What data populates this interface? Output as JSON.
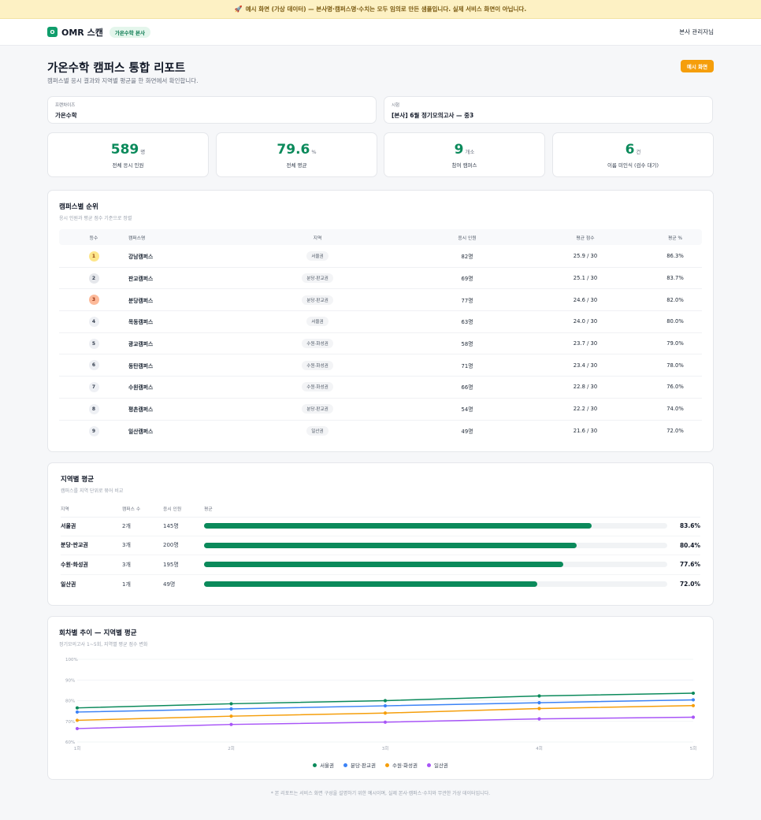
{
  "banner": {
    "icon": "🚀",
    "text": "예시 화면 (가상 데이터) — 본사명·캠퍼스명·수치는 모두 임의로 만든 샘플입니다. 실제 서비스 화면이 아닙니다."
  },
  "header": {
    "logo_mark": "O",
    "app_name": "OMR 스캔",
    "brand_badge": "가온수학 본사",
    "user": "본사 관리자님"
  },
  "page": {
    "title": "가온수학 캠퍼스 통합 리포트",
    "subtitle": "캠퍼스별 응시 결과와 지역별 평균을 한 화면에서 확인합니다.",
    "example_button": "예시 화면"
  },
  "filters": {
    "franchise": {
      "label": "프랜차이즈",
      "value": "가온수학"
    },
    "exam": {
      "label": "시험",
      "value": "[본사] 6월 정기모의고사 — 중3"
    }
  },
  "stats": [
    {
      "value": "589",
      "unit": "명",
      "caption": "전체 응시 인원"
    },
    {
      "value": "79.6",
      "unit": "%",
      "caption": "전체 평균"
    },
    {
      "value": "9",
      "unit": "개소",
      "caption": "참여 캠퍼스"
    },
    {
      "value": "6",
      "unit": "건",
      "caption": "이름 미인식 (검수 대기)"
    }
  ],
  "ranking": {
    "title": "캠퍼스별 순위",
    "subtitle": "응시 인원과 평균 점수 기준으로 정렬",
    "columns": [
      "등수",
      "캠퍼스명",
      "지역",
      "응시 인원",
      "평균 점수",
      "평균 %"
    ],
    "rows": [
      {
        "rank": "1",
        "name": "강남캠퍼스",
        "region": "서울권",
        "count": "82명",
        "avg": "25.9 / 30",
        "pct": "86.3%"
      },
      {
        "rank": "2",
        "name": "판교캠퍼스",
        "region": "분당·판교권",
        "count": "69명",
        "avg": "25.1 / 30",
        "pct": "83.7%"
      },
      {
        "rank": "3",
        "name": "분당캠퍼스",
        "region": "분당·판교권",
        "count": "77명",
        "avg": "24.6 / 30",
        "pct": "82.0%"
      },
      {
        "rank": "4",
        "name": "목동캠퍼스",
        "region": "서울권",
        "count": "63명",
        "avg": "24.0 / 30",
        "pct": "80.0%"
      },
      {
        "rank": "5",
        "name": "광교캠퍼스",
        "region": "수원·화성권",
        "count": "58명",
        "avg": "23.7 / 30",
        "pct": "79.0%"
      },
      {
        "rank": "6",
        "name": "동탄캠퍼스",
        "region": "수원·화성권",
        "count": "71명",
        "avg": "23.4 / 30",
        "pct": "78.0%"
      },
      {
        "rank": "7",
        "name": "수원캠퍼스",
        "region": "수원·화성권",
        "count": "66명",
        "avg": "22.8 / 30",
        "pct": "76.0%"
      },
      {
        "rank": "8",
        "name": "평촌캠퍼스",
        "region": "분당·판교권",
        "count": "54명",
        "avg": "22.2 / 30",
        "pct": "74.0%"
      },
      {
        "rank": "9",
        "name": "일산캠퍼스",
        "region": "일산권",
        "count": "49명",
        "avg": "21.6 / 30",
        "pct": "72.0%"
      }
    ]
  },
  "regions": {
    "title": "지역별 평균",
    "subtitle": "캠퍼스를 지역 단위로 묶어 비교",
    "columns": [
      "지역",
      "캠퍼스 수",
      "응시 인원",
      "평균"
    ],
    "rows": [
      {
        "name": "서울권",
        "campuses": "2개",
        "count": "145명",
        "pct_label": "83.6%",
        "pct": 83.6
      },
      {
        "name": "분당·판교권",
        "campuses": "3개",
        "count": "200명",
        "pct_label": "80.4%",
        "pct": 80.4
      },
      {
        "name": "수원·화성권",
        "campuses": "3개",
        "count": "195명",
        "pct_label": "77.6%",
        "pct": 77.6
      },
      {
        "name": "일산권",
        "campuses": "1개",
        "count": "49명",
        "pct_label": "72.0%",
        "pct": 72.0
      }
    ]
  },
  "trend": {
    "title": "회차별 추이 — 지역별 평균",
    "subtitle": "정기모의고사 1~5회, 지역별 평균 점수 변화"
  },
  "chart_data": {
    "type": "line",
    "x": [
      "1회",
      "2회",
      "3회",
      "4회",
      "5회"
    ],
    "ylim": [
      60,
      100
    ],
    "yticks": [
      "60%",
      "70%",
      "80%",
      "90%",
      "100%"
    ],
    "grid": true,
    "legend": "bottom-center",
    "series": [
      {
        "name": "서울권",
        "color": "#0b8a5b",
        "values": [
          76.5,
          78.5,
          80.0,
          82.3,
          83.6
        ]
      },
      {
        "name": "분당·판교권",
        "color": "#3b82f6",
        "values": [
          74.5,
          76.0,
          77.5,
          79.0,
          80.4
        ]
      },
      {
        "name": "수원·화성권",
        "color": "#f59e0b",
        "values": [
          70.5,
          72.5,
          74.0,
          76.2,
          77.6
        ]
      },
      {
        "name": "일산권",
        "color": "#a855f7",
        "values": [
          66.5,
          68.5,
          69.6,
          71.2,
          72.0
        ]
      }
    ]
  },
  "footer": {
    "note": "* 본 리포트는 서비스 화면 구성을 설명하기 위한 예시이며, 실제 본사·캠퍼스·수치와 무관한 가상 데이터입니다."
  }
}
